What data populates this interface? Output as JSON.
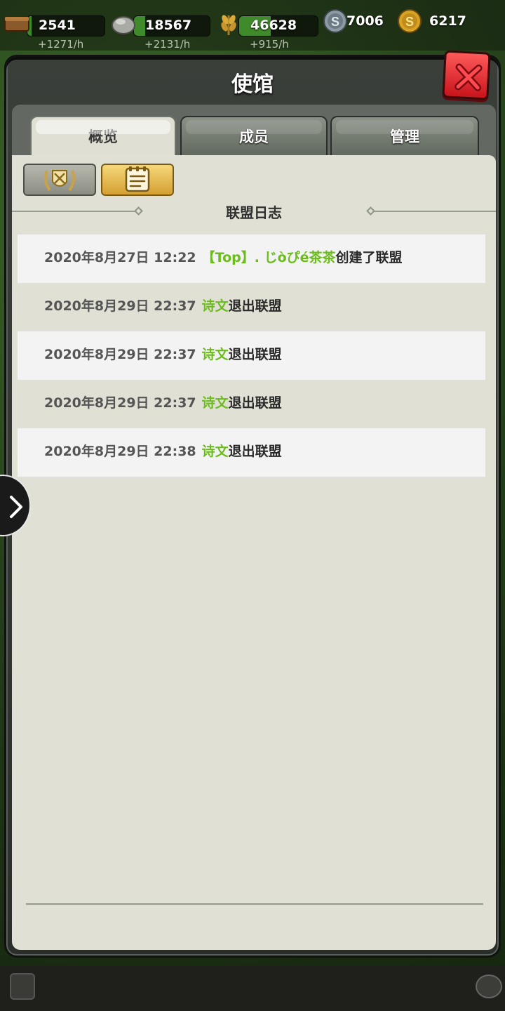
{
  "resources": {
    "wood": {
      "icon": "wood-icon",
      "value": "2541",
      "rate": "+1271/h",
      "fill_fraction": 0.05
    },
    "stone": {
      "icon": "stone-icon",
      "value": "18567",
      "rate": "+2131/h",
      "fill_fraction": 0.15
    },
    "food": {
      "icon": "wheat-icon",
      "value": "46628",
      "rate": "+915/h",
      "fill_fraction": 0.4
    },
    "silver": {
      "icon": "silver-coin-icon",
      "value": "7006"
    },
    "gold": {
      "icon": "gold-coin-icon",
      "value": "6217"
    }
  },
  "dialog": {
    "title": "使馆",
    "tabs": [
      {
        "label": "概览",
        "active": true
      },
      {
        "label": "成员",
        "active": false
      },
      {
        "label": "管理",
        "active": false
      }
    ],
    "section_title": "联盟日志",
    "logs": [
      {
        "date": "2020年8月27日 12:22",
        "name": "【Top】. じòぴé茶茶",
        "action": "创建了联盟"
      },
      {
        "date": "2020年8月29日 22:37",
        "name": "诗文",
        "action": "退出联盟"
      },
      {
        "date": "2020年8月29日 22:37",
        "name": "诗文",
        "action": "退出联盟"
      },
      {
        "date": "2020年8月29日 22:37",
        "name": "诗文",
        "action": "退出联盟"
      },
      {
        "date": "2020年8月29日 22:38",
        "name": "诗文",
        "action": "退出联盟"
      }
    ]
  },
  "colors": {
    "accent_green": "#6cbc1e",
    "close_red": "#e2232b",
    "gold_tab": "#e8bd52"
  }
}
